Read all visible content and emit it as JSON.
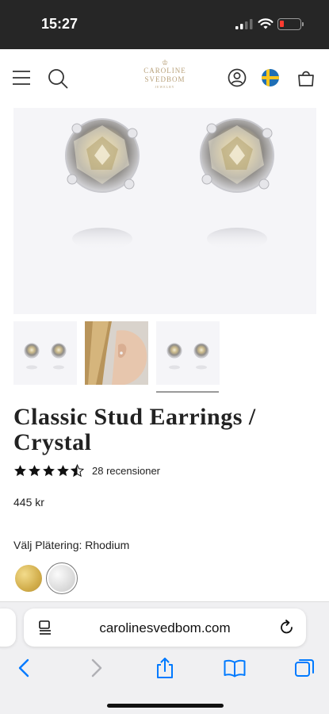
{
  "status_bar": {
    "time": "15:27"
  },
  "header": {
    "brand_line1": "CAROLINE",
    "brand_line2": "SVEDBOM",
    "brand_sub": "JEWELRY",
    "icons": [
      "menu-icon",
      "search-icon",
      "account-icon",
      "sweden-flag-icon",
      "bag-icon"
    ]
  },
  "product": {
    "title": "Classic Stud Earrings / Crystal",
    "rating": 4.5,
    "reviews_label": "28 recensioner",
    "price": "445 kr",
    "plating_label": "Välj Plätering: Rhodium",
    "swatches": [
      "Gold",
      "Rhodium"
    ],
    "selected_swatch": "Rhodium",
    "selected_thumbnail": 3
  },
  "browser": {
    "url": "carolinesvedbom.com"
  },
  "colors": {
    "status_bar_bg": "#262626",
    "brand_gold": "#b8a17a",
    "ios_blue": "#007aff",
    "battery_red": "#ff3b30"
  }
}
